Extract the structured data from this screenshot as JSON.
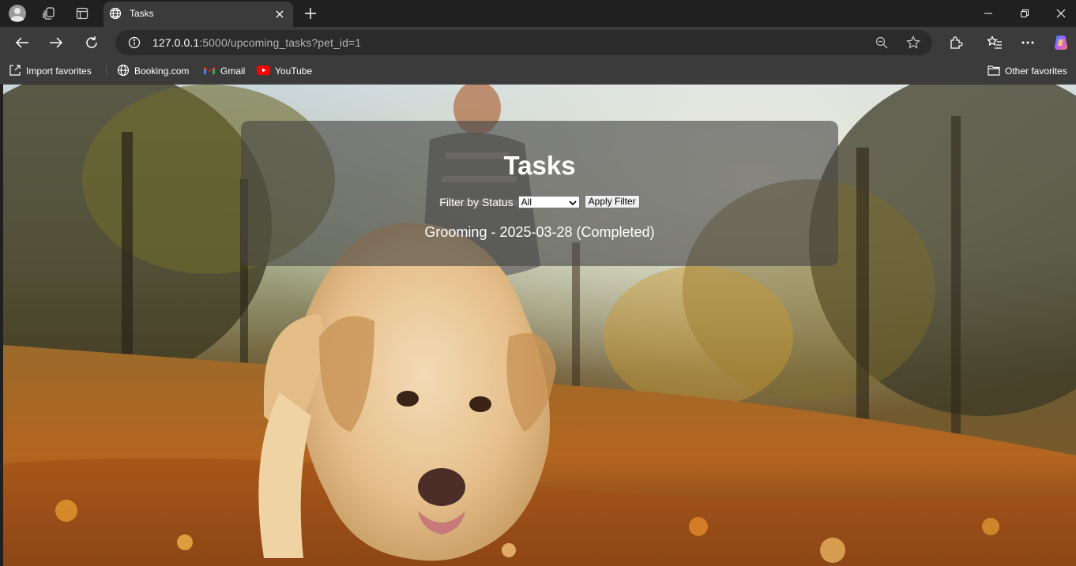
{
  "browser": {
    "tab": {
      "title": "Tasks"
    },
    "address": {
      "host": "127.0.0.1",
      "path": ":5000/upcoming_tasks?pet_id=1"
    },
    "favorites": [
      {
        "label": "Import favorites",
        "icon": "import-icon"
      },
      {
        "label": "Booking.com",
        "icon": "globe-icon"
      },
      {
        "label": "Gmail",
        "icon": "gmail-icon"
      },
      {
        "label": "YouTube",
        "icon": "youtube-icon"
      }
    ],
    "other_favorites": {
      "label": "Other favorites",
      "icon": "folder-icon"
    },
    "colors": {
      "chrome_dark": "#202020",
      "chrome": "#3b3b3b",
      "omnibox": "#2b2b2b"
    }
  },
  "page": {
    "title": "Tasks",
    "filter": {
      "label": "Filter by Status",
      "selected": "All",
      "button": "Apply Filter"
    },
    "tasks": [
      {
        "text": "Grooming - 2025-03-28 (Completed)"
      }
    ],
    "background": "photo of a golden retriever walking on autumn leaves in a park",
    "panel_color": "rgba(70,70,70,0.62)"
  }
}
